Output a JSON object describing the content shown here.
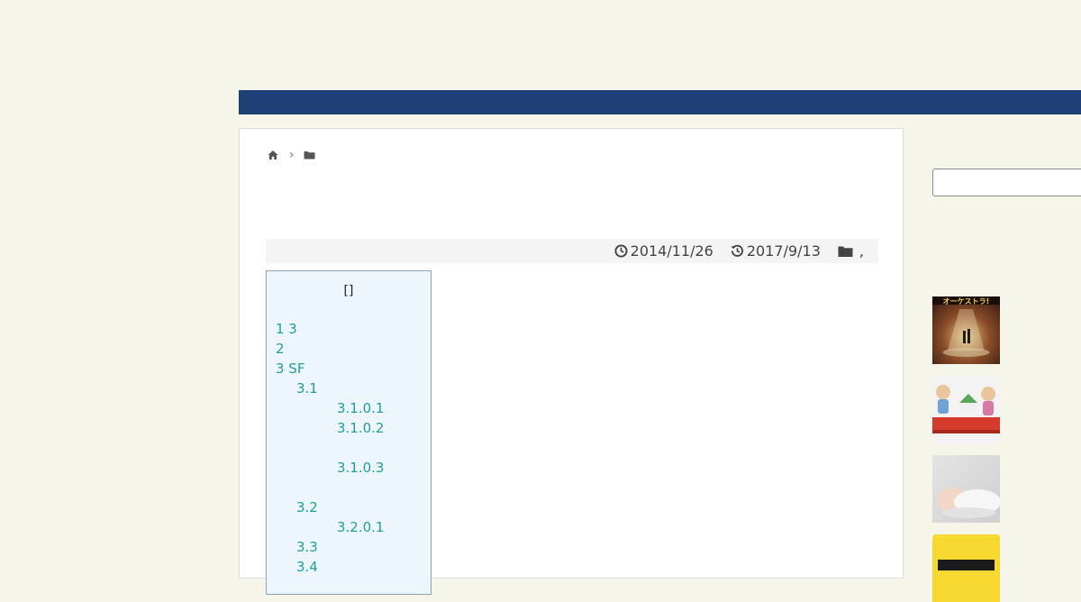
{
  "meta": {
    "published_date": "2014/11/26",
    "updated_date": "2017/9/13",
    "category_separator": ","
  },
  "toc": {
    "title": "[]",
    "items": [
      {
        "label": "1 3",
        "level": 1
      },
      {
        "label": "2",
        "level": 1
      },
      {
        "label": "3 SF",
        "level": 1
      },
      {
        "label": "3.1",
        "level": 2
      },
      {
        "label": "3.1.0.1",
        "level": 3
      },
      {
        "label": "3.1.0.2",
        "level": 3
      },
      {
        "label": "",
        "level": 0
      },
      {
        "label": "3.1.0.3",
        "level": 3
      },
      {
        "label": "",
        "level": 0
      },
      {
        "label": "3.2",
        "level": 2
      },
      {
        "label": "3.2.0.1",
        "level": 3
      },
      {
        "label": "3.3",
        "level": 2
      },
      {
        "label": "3.4",
        "level": 2
      }
    ]
  },
  "sidebar": {
    "thumb1_text": "オーケストラ!"
  },
  "colors": {
    "navbar": "#1f4077",
    "toc_link": "#1f9e9e",
    "toc_bg": "#eef6fd"
  }
}
